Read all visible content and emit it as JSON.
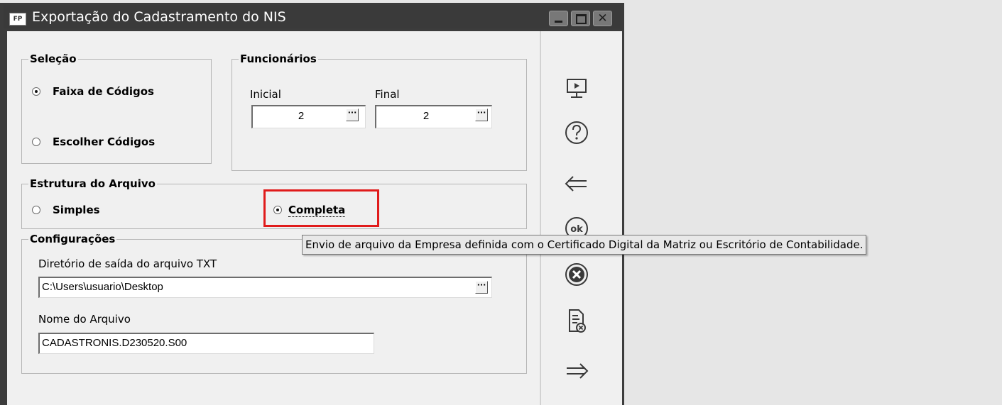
{
  "window": {
    "title": "Exportação do Cadastramento do NIS",
    "app_icon_text": "FP",
    "minimize_label": "",
    "maximize_label": "",
    "close_label": "✕"
  },
  "selecao": {
    "title": "Seleção",
    "options": [
      {
        "label": "Faixa de Códigos",
        "checked": true
      },
      {
        "label": "Escolher Códigos",
        "checked": false
      }
    ]
  },
  "funcionarios": {
    "title": "Funcionários",
    "inicial_label": "Inicial",
    "final_label": "Final",
    "inicial_value": "2",
    "final_value": "2",
    "lookup_button": "···"
  },
  "estrutura": {
    "title": "Estrutura do Arquivo",
    "options": [
      {
        "label": "Simples",
        "checked": false
      },
      {
        "label": "Completa",
        "checked": true
      }
    ]
  },
  "configuracoes": {
    "title": "Configurações",
    "dir_label": "Diretório de saída do arquivo TXT",
    "dir_value": "C:\\Users\\usuario\\Desktop",
    "name_label": "Nome do Arquivo",
    "name_value": "CADASTRONIS.D230520.S00",
    "browse_button": "···"
  },
  "tooltip": {
    "text": "Envio de arquivo da Empresa definida com o Certificado Digital da Matriz ou Escritório de Contabilidade."
  },
  "side_icons": [
    "monitor-icon",
    "help-icon",
    "back-arrow-icon",
    "ok-icon",
    "cancel-icon",
    "document-delete-icon",
    "forward-arrow-icon"
  ],
  "colors": {
    "highlight": "#e01b1b",
    "titlebar": "#3a3a3a",
    "window_bg": "#f0f0f0"
  }
}
